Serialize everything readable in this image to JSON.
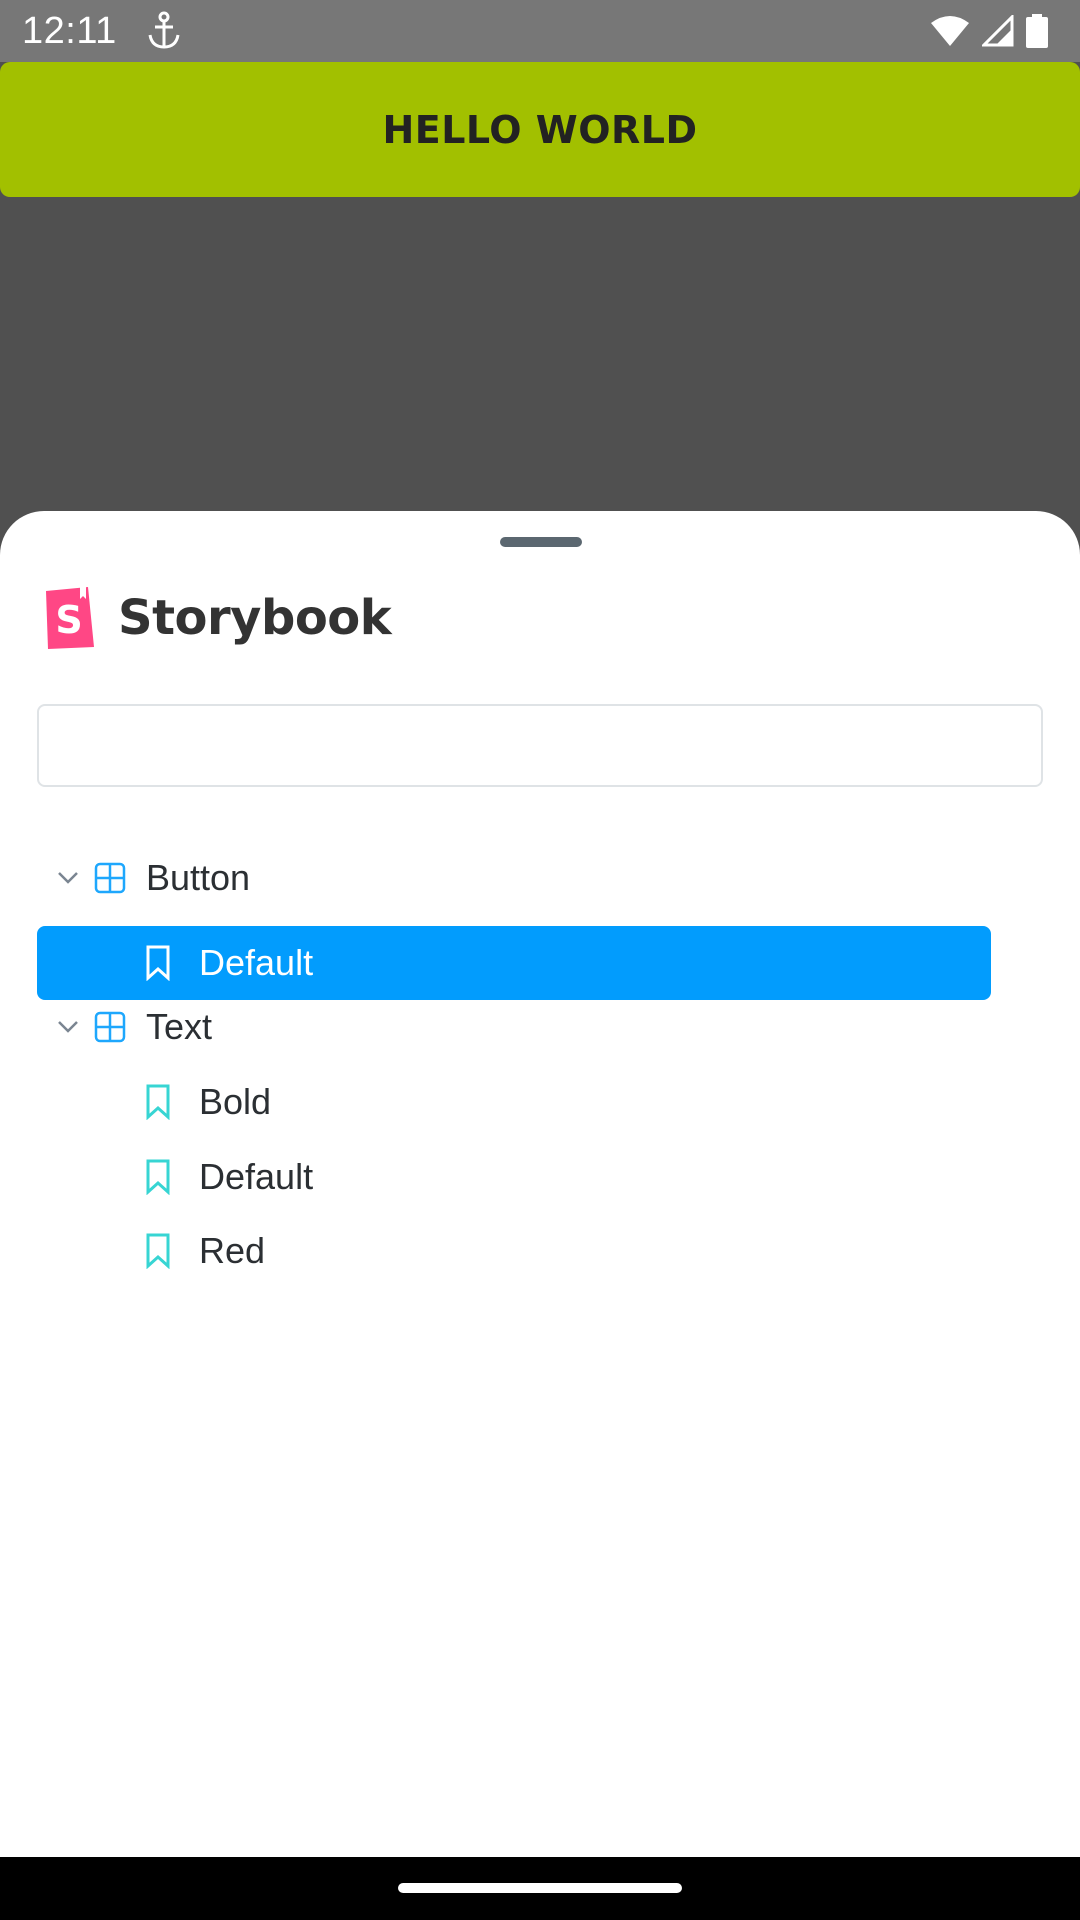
{
  "status_bar": {
    "time": "12:11",
    "icons": [
      "anchor-icon",
      "wifi-icon",
      "cell-signal-icon",
      "battery-icon"
    ]
  },
  "preview": {
    "button_label": "HELLO WORLD",
    "button_color": "#a2c000",
    "background_color": "#505050"
  },
  "sheet": {
    "brand": "Storybook",
    "brand_color": "#ff4785",
    "search": {
      "value": "",
      "placeholder": ""
    },
    "tree": {
      "components": [
        {
          "label": "Button",
          "expanded": true,
          "stories": [
            {
              "label": "Default",
              "selected": true
            }
          ]
        },
        {
          "label": "Text",
          "expanded": true,
          "stories": [
            {
              "label": "Bold",
              "selected": false
            },
            {
              "label": "Default",
              "selected": false
            },
            {
              "label": "Red",
              "selected": false
            }
          ]
        }
      ]
    },
    "colors": {
      "selected_row": "#029cfd",
      "component_icon": "#1ea7fd",
      "story_icon": "#37d5d3"
    }
  }
}
